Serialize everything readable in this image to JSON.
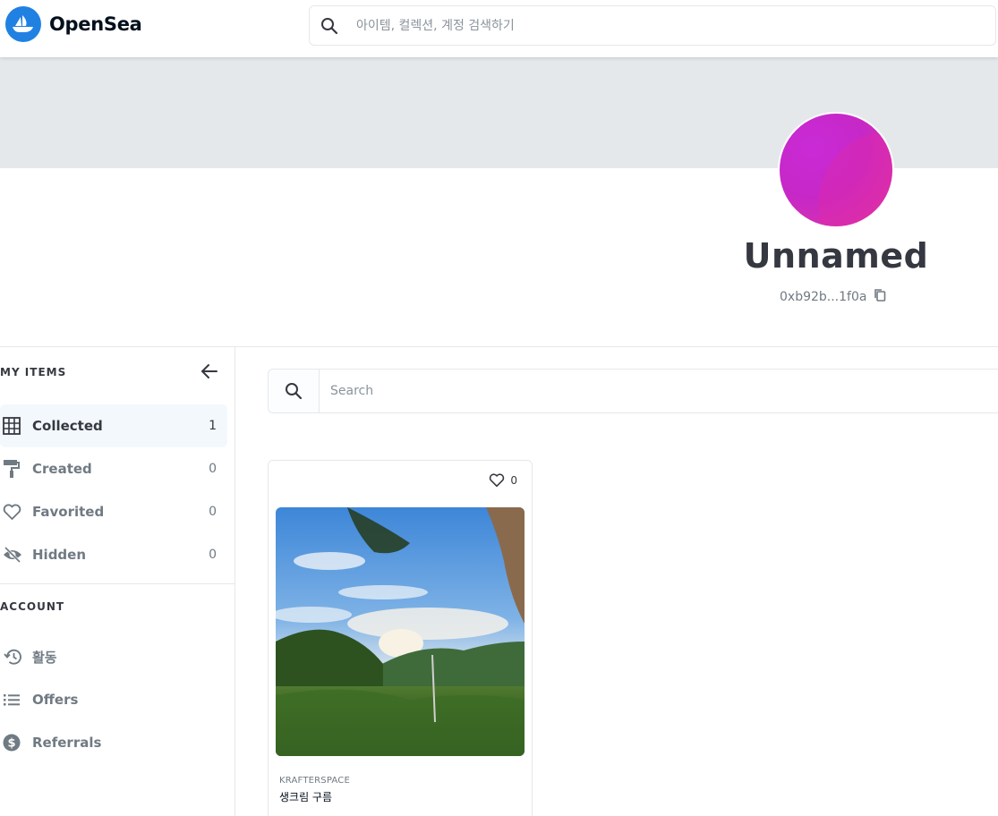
{
  "header": {
    "brand": "OpenSea",
    "search_placeholder": "아이템, 컬렉션, 계정 검색하기"
  },
  "profile": {
    "name": "Unnamed",
    "address": "0xb92b...1f0a"
  },
  "sidebar": {
    "my_items_title": "MY ITEMS",
    "items": [
      {
        "label": "Collected",
        "count": "1",
        "icon": "grid-icon"
      },
      {
        "label": "Created",
        "count": "0",
        "icon": "paint-roller-icon"
      },
      {
        "label": "Favorited",
        "count": "0",
        "icon": "heart-icon"
      },
      {
        "label": "Hidden",
        "count": "0",
        "icon": "eye-off-icon"
      }
    ],
    "account_title": "ACCOUNT",
    "account_items": [
      {
        "label": "활동",
        "icon": "history-icon"
      },
      {
        "label": "Offers",
        "icon": "list-icon"
      },
      {
        "label": "Referrals",
        "icon": "dollar-circle-icon"
      }
    ]
  },
  "main": {
    "search_placeholder": "Search",
    "card": {
      "likes": "0",
      "collection": "KRAFTERSPACE",
      "title": "생크림 구름"
    }
  },
  "colors": {
    "brand_blue": "#2081e2",
    "banner_gray": "#e5e8eb",
    "text_dark": "#353840",
    "text_muted": "#707a83"
  }
}
